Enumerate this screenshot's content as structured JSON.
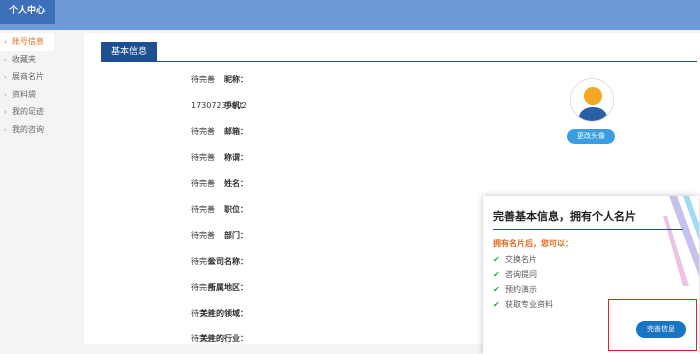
{
  "header": {
    "tab_label": "个人中心"
  },
  "sidebar": {
    "items": [
      {
        "label": "账号信息",
        "active": true
      },
      {
        "label": "收藏夹",
        "active": false
      },
      {
        "label": "展商名片",
        "active": false
      },
      {
        "label": "资料袋",
        "active": false
      },
      {
        "label": "我的足迹",
        "active": false
      },
      {
        "label": "我的咨询",
        "active": false
      }
    ]
  },
  "main": {
    "section_title": "基本信息",
    "fields": [
      {
        "label": "昵称：",
        "value": "待完善"
      },
      {
        "label": "手机：",
        "value": "17307239902"
      },
      {
        "label": "邮箱：",
        "value": "待完善"
      },
      {
        "label": "称谓：",
        "value": "待完善"
      },
      {
        "label": "姓名：",
        "value": "待完善"
      },
      {
        "label": "职位：",
        "value": "待完善"
      },
      {
        "label": "部门：",
        "value": "待完善"
      },
      {
        "label": "公司名称：",
        "value": "待完善"
      },
      {
        "label": "所属地区：",
        "value": "待完善"
      },
      {
        "label": "关注的领域：",
        "value": "待完善"
      },
      {
        "label": "关注的行业：",
        "value": "待完善"
      }
    ],
    "avatar_button": "更改头像"
  },
  "promo": {
    "title": "完善基本信息，拥有个人名片",
    "subtitle": "拥有名片后，您可以：",
    "features": [
      "交换名片",
      "咨询提问",
      "预约演示",
      "获取专业资料"
    ],
    "button": "完善信息"
  },
  "colors": {
    "topbar": "#6f9ad8",
    "tab": "#3d6fba",
    "section": "#1d4f91",
    "accent_orange": "#e06b1f",
    "check_green": "#3aa63a",
    "button_blue": "#1a74c4",
    "highlight_red": "#e0251b"
  },
  "icons": {
    "avatar": "user-avatar-icon",
    "check": "checkmark-icon",
    "arrow": "chevron-right-icon"
  }
}
